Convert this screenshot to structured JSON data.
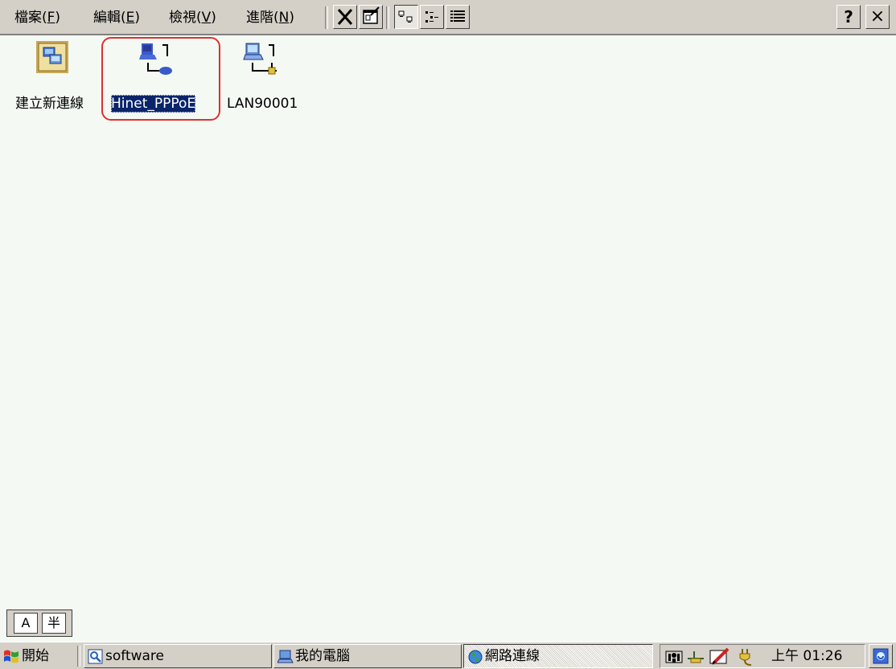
{
  "menubar": {
    "items": [
      {
        "label": "檔案(",
        "key": "F",
        "close": ")"
      },
      {
        "label": "編輯(",
        "key": "E",
        "close": ")"
      },
      {
        "label": "檢視(",
        "key": "V",
        "close": ")"
      },
      {
        "label": "進階(",
        "key": "N",
        "close": ")"
      }
    ]
  },
  "toolbar": {
    "icons": [
      "delete-icon",
      "properties-icon",
      "large-icons-view-icon",
      "small-icons-view-icon",
      "details-view-icon"
    ],
    "help_label": "?",
    "close_label": "×",
    "active_view": "large-icons"
  },
  "desktop": {
    "icons": [
      {
        "label": "建立新連線",
        "icon": "new-connection-icon",
        "selected": false
      },
      {
        "label": "Hinet_PPPoE",
        "icon": "dialup-connection-icon",
        "selected": true
      },
      {
        "label": "LAN90001",
        "icon": "lan-connection-icon",
        "selected": false
      }
    ],
    "highlight_color": "#e03030"
  },
  "input_panel": {
    "keys": [
      "A",
      "半"
    ]
  },
  "taskbar": {
    "start_label": "開始",
    "buttons": [
      {
        "label": "software",
        "icon": "explorer-icon",
        "active": false
      },
      {
        "label": "我的電腦",
        "icon": "my-computer-icon",
        "active": false
      },
      {
        "label": "網路連線",
        "icon": "network-globe-icon",
        "active": true
      }
    ],
    "tray_icons": [
      "network-tray-icon",
      "ethernet-tray-icon",
      "pen-tray-icon",
      "power-plug-icon"
    ],
    "clock": "上午 01:26",
    "desktop_icon": "show-desktop-icon"
  },
  "colors": {
    "background": "#f4f9f4",
    "chrome": "#d4d0c8",
    "selection": "#0a246a"
  }
}
